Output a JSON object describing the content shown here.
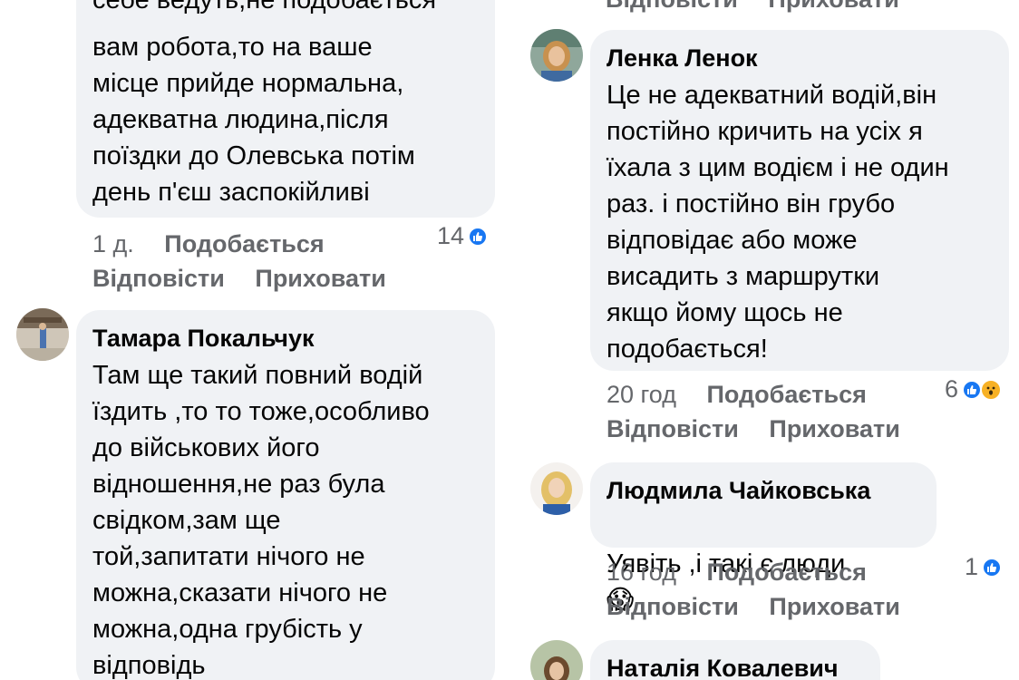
{
  "comments": [
    {
      "id": "c1",
      "text": "вам робота,то на ваше\nмісце прийде нормальна,\nадекватна людина,після\nпоїздки до Олевська потім\nдень п'єш заспокійливі",
      "time": "1 д.",
      "like_label": "Подобається",
      "reply_label": "Відповісти",
      "hide_label": "Приховати",
      "reaction_count": "14",
      "reactions": [
        "like-icon"
      ]
    },
    {
      "id": "c2",
      "author": "Тамара Покальчук",
      "text": "Там ще такий повний водій\nїздить ,то то тоже,особливо\nдо військових його\nвідношення,не раз була\nсвідком,зам ще\nтой,запитати нічого не\nможна,сказати нічого не\nможна,одна грубість у\nвідповідь"
    },
    {
      "id": "c3",
      "author": "Ленка Ленок",
      "text": "Це не адекватний водій,він\nпостійно кричить на усіх я\nїхала з цим водієм і не один\nраз. і постійно він грубо\nвідповідає або може\nвисадить з маршрутки\nякщо йому щось не\nподобається!",
      "time": "20 год",
      "like_label": "Подобається",
      "reply_label": "Відповісти",
      "hide_label": "Приховати",
      "reaction_count": "6",
      "reactions": [
        "like-icon",
        "wow-icon"
      ]
    },
    {
      "id": "c4",
      "author": "Людмила Чайковська",
      "text": "Уявіть ,і такі є люди",
      "emoji": "😱",
      "time": "16 год",
      "like_label": "Подобається",
      "reply_label": "Відповісти",
      "hide_label": "Приховати",
      "reaction_count": "1",
      "reactions": [
        "like-icon"
      ]
    },
    {
      "id": "c5",
      "author": "Наталія Ковалевич"
    }
  ],
  "top_right": {
    "reply_label": "Відповісти",
    "hide_label": "Приховати"
  },
  "colors": {
    "bubble": "#f0f2f5",
    "meta": "#65676b",
    "like": "#1877f2"
  }
}
